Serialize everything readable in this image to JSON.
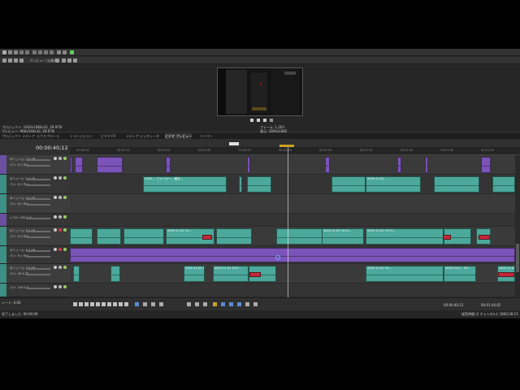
{
  "menu": {
    "preview_combo": "プレビュー (自動)"
  },
  "preview": {
    "project_label": "プロジェクト:",
    "project_value": "1920x1080x32, 29.970i",
    "preview_label": "プレビュー:",
    "preview_value": "960x540x32, 29.970i",
    "display_label": "表示:",
    "display_value": "",
    "frame_label": "フレーム:",
    "frame_value": "1,203",
    "display2_label": "表示:",
    "display2_value": "1904x1082"
  },
  "tabs": [
    "プロジェクト メディア",
    "エクスプローラ",
    "トランジション",
    "ビデオ FX",
    "メディア ジェネレータ",
    "ビデオ プレビュー",
    "トリマー"
  ],
  "timecode": "00:00:40;12",
  "ruler_ticks": [
    "00:00:00",
    "00:00:10",
    "00:00:20",
    "00:00:30",
    "00:00:40",
    "00:00:50",
    "00:01:00",
    "00:01:10",
    "00:01:20",
    "00:01:30",
    "00:01:40"
  ],
  "tracks": [
    {
      "type": "video",
      "num": "1",
      "lines": [
        "ボリューム:  0.0 dB",
        "パン:   センター"
      ]
    },
    {
      "type": "audio",
      "num": "2",
      "lines": [
        "ボリューム:  0.0 dB",
        "パン:   センター"
      ]
    },
    {
      "type": "audio",
      "num": "3",
      "lines": [
        "ボリューム:  0.0 dB",
        "パン:   センター"
      ]
    },
    {
      "type": "video",
      "num": "4",
      "lines": [
        "レベル:   100.0 %"
      ]
    },
    {
      "type": "audio",
      "num": "5",
      "lines": [
        "ボリューム:  6.7 dB",
        "パン:   センター"
      ]
    },
    {
      "type": "audio",
      "num": "6",
      "lines": [
        "ボリューム:  6.7 dB",
        "パン:   センター"
      ]
    },
    {
      "type": "audio",
      "num": "7",
      "lines": [
        "ボリューム:  3.3 dB",
        "パン:   18 % 左"
      ]
    },
    {
      "type": "audio",
      "num": "8",
      "lines": [
        "パン:   100.0 %"
      ]
    }
  ],
  "clips": {
    "c1": "2025-... フォーカー... 魔法...",
    "c2": "2025-11-02 ...",
    "c3": "2025-11-02 19:...",
    "c4": "2025-11-02 19:21...",
    "c5": "2025-11-02 19:21...",
    "c6": "2025-11-02 19:21...",
    "c7": "2025-11-02 19:2...",
    "c8": "2025-11-02 19:3...",
    "c9": "2025-11-02 19:...",
    "c10": "2025-11-0... 19:...",
    "c11": "2025-11-02 19:..."
  },
  "status": {
    "left": "完了しました: 00:00:00",
    "rate_label": "レート: 0.00",
    "time_right": "00:00:40;12",
    "record_label": "録音時間 (2 チャンネル): 1860:28:15",
    "end_time": "00:01:44;02"
  },
  "colors": {
    "teal_clip": "#4ba89a",
    "purple_clip": "#7b54b8",
    "red_clip": "#c2283a"
  }
}
